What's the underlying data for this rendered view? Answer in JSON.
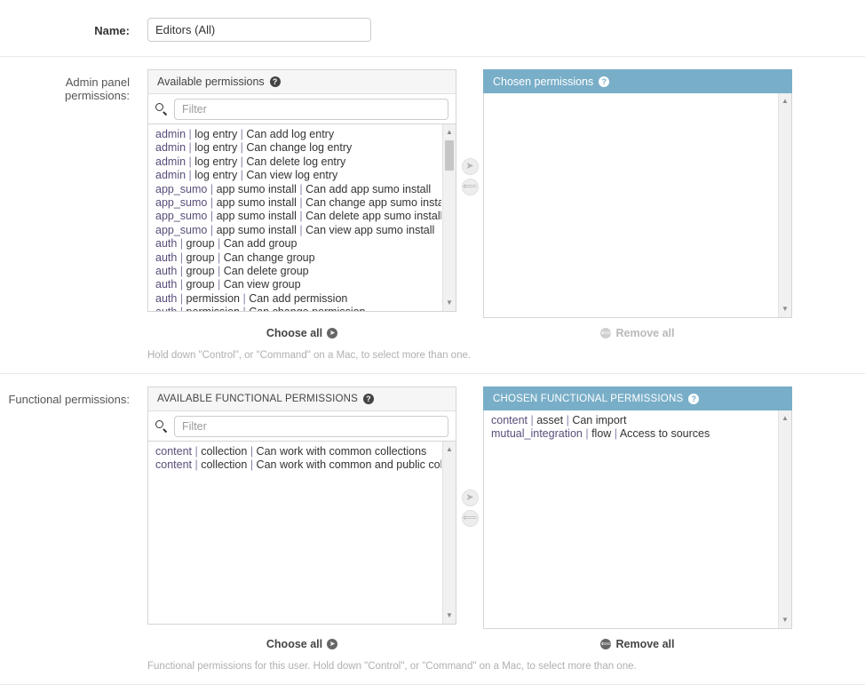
{
  "name_field": {
    "label": "Name:",
    "value": "Editors (All)"
  },
  "admin_permissions": {
    "label": "Admin panel permissions:",
    "available": {
      "header": "Available permissions",
      "help_icon": "?",
      "filter_placeholder": "Filter",
      "search_icon": "search-icon",
      "items": [
        "admin | log entry | Can add log entry",
        "admin | log entry | Can change log entry",
        "admin | log entry | Can delete log entry",
        "admin | log entry | Can view log entry",
        "app_sumo | app sumo install | Can add app sumo install",
        "app_sumo | app sumo install | Can change app sumo install",
        "app_sumo | app sumo install | Can delete app sumo install",
        "app_sumo | app sumo install | Can view app sumo install",
        "auth | group | Can add group",
        "auth | group | Can change group",
        "auth | group | Can delete group",
        "auth | group | Can view group",
        "auth | permission | Can add permission",
        "auth | permission | Can change permission"
      ],
      "choose_all_label": "Choose all",
      "choose_all_icon": "arrow-right-circle-icon"
    },
    "chosen": {
      "header": "Chosen permissions",
      "help_icon": "?",
      "items": [],
      "remove_all_label": "Remove all",
      "remove_all_icon": "arrow-left-circle-icon",
      "remove_all_disabled": true
    },
    "chooser": {
      "add_icon": "arrow-right-circle-icon",
      "remove_icon": "arrow-left-circle-icon"
    },
    "help_text": "Hold down \"Control\", or \"Command\" on a Mac, to select more than one."
  },
  "functional_permissions": {
    "label": "Functional permissions:",
    "available": {
      "header": "AVAILABLE FUNCTIONAL PERMISSIONS",
      "help_icon": "?",
      "filter_placeholder": "Filter",
      "search_icon": "search-icon",
      "items": [
        "content | collection | Can work with common collections",
        "content | collection | Can work with common and public colle"
      ],
      "choose_all_label": "Choose all",
      "choose_all_icon": "arrow-right-circle-icon"
    },
    "chosen": {
      "header": "CHOSEN FUNCTIONAL PERMISSIONS",
      "help_icon": "?",
      "items": [
        "content | asset | Can import",
        "mutual_integration | flow | Access to sources"
      ],
      "remove_all_label": "Remove all",
      "remove_all_icon": "arrow-left-circle-icon",
      "remove_all_disabled": false
    },
    "chooser": {
      "add_icon": "arrow-right-circle-icon",
      "remove_icon": "arrow-left-circle-icon"
    },
    "help_text": "Functional permissions for this user. Hold down \"Control\", or \"Command\" on a Mac, to select more than one."
  },
  "colors": {
    "chosen_header_bg": "#79aec8",
    "panel_border": "#d5d5d5",
    "available_header_bg": "#f6f6f6"
  }
}
